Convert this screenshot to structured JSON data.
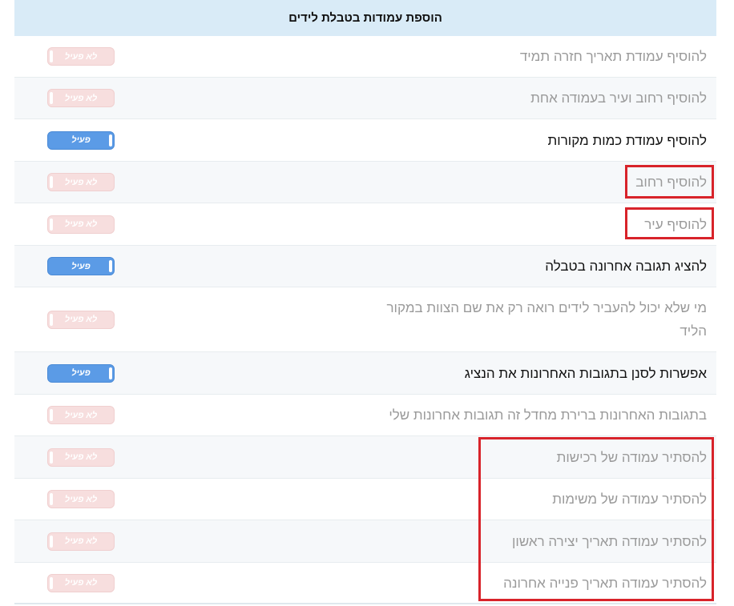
{
  "panel": {
    "title": "הוספת עמודות בטבלת לידים"
  },
  "rows": [
    {
      "label": "להוסיף עמודת תאריך חזרה תמיד",
      "state": "לא פעיל"
    },
    {
      "label": "להוסיף רחוב ועיר בעמודה אחת",
      "state": "לא פעיל"
    },
    {
      "label": "להוסיף עמודת כמות מקורות",
      "state": "פעיל"
    },
    {
      "label": "להוסיף רחוב",
      "state": "לא פעיל"
    },
    {
      "label": "להוסיף עיר",
      "state": "לא פעיל"
    },
    {
      "label": "להציג תגובה אחרונה בטבלה",
      "state": "פעיל"
    },
    {
      "label": "מי שלא יכול להעביר לידים רואה רק את שם הצוות במקור הליד",
      "state": "לא פעיל"
    },
    {
      "label": "אפשרות לסנן בתגובות האחרונות את הנציג",
      "state": "פעיל"
    },
    {
      "label": "בתגובות האחרונות ברירת מחדל זה תגובות אחרונות שלי",
      "state": "לא פעיל"
    },
    {
      "label": "להסתיר עמודה של רכישות",
      "state": "לא פעיל"
    },
    {
      "label": "להסתיר עמודה של משימות",
      "state": "לא פעיל"
    },
    {
      "label": "להסתיר עמודה תאריך יצירה ראשון",
      "state": "לא פעיל"
    },
    {
      "label": "להסתיר עמודה תאריך פנייה אחרונה",
      "state": "לא פעיל"
    }
  ],
  "colors": {
    "header_bg": "#d9ebf7",
    "toggle_on": "#5b9be6",
    "toggle_off": "#f7dede",
    "highlight": "#d8232a"
  }
}
